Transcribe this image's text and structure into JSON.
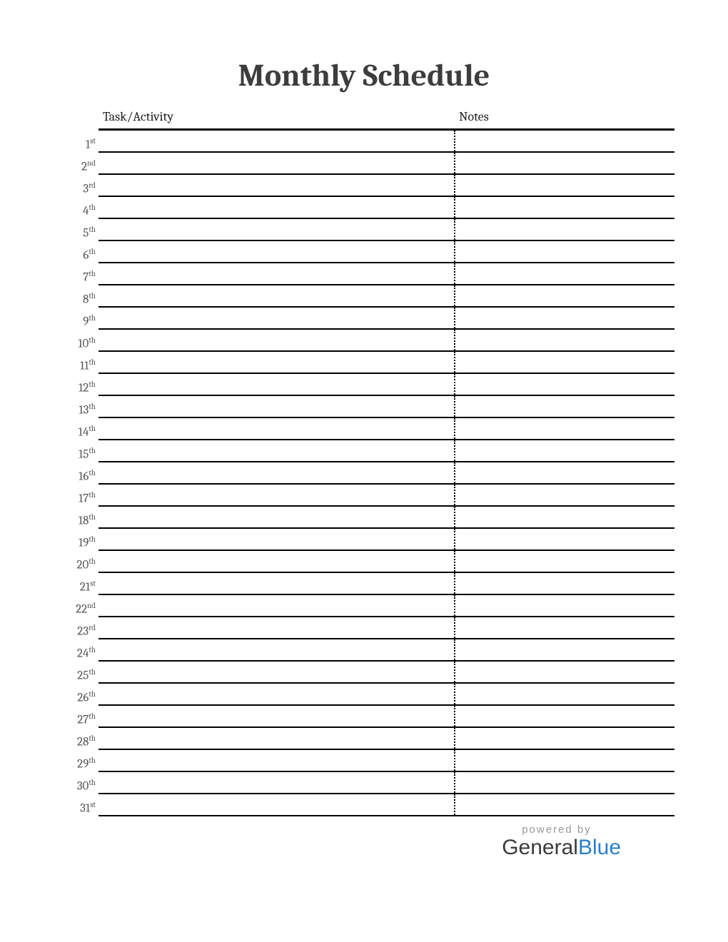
{
  "title": "Monthly Schedule",
  "columns": {
    "task": "Task/Activity",
    "notes": "Notes"
  },
  "days": [
    {
      "num": "1",
      "suffix": "st"
    },
    {
      "num": "2",
      "suffix": "nd"
    },
    {
      "num": "3",
      "suffix": "rd"
    },
    {
      "num": "4",
      "suffix": "th"
    },
    {
      "num": "5",
      "suffix": "th"
    },
    {
      "num": "6",
      "suffix": "th"
    },
    {
      "num": "7",
      "suffix": "th"
    },
    {
      "num": "8",
      "suffix": "th"
    },
    {
      "num": "9",
      "suffix": "th"
    },
    {
      "num": "10",
      "suffix": "th"
    },
    {
      "num": "11",
      "suffix": "th"
    },
    {
      "num": "12",
      "suffix": "th"
    },
    {
      "num": "13",
      "suffix": "th"
    },
    {
      "num": "14",
      "suffix": "th"
    },
    {
      "num": "15",
      "suffix": "th"
    },
    {
      "num": "16",
      "suffix": "th"
    },
    {
      "num": "17",
      "suffix": "th"
    },
    {
      "num": "18",
      "suffix": "th"
    },
    {
      "num": "19",
      "suffix": "th"
    },
    {
      "num": "20",
      "suffix": "th"
    },
    {
      "num": "21",
      "suffix": "st"
    },
    {
      "num": "22",
      "suffix": "nd"
    },
    {
      "num": "23",
      "suffix": "rd"
    },
    {
      "num": "24",
      "suffix": "th"
    },
    {
      "num": "25",
      "suffix": "th"
    },
    {
      "num": "26",
      "suffix": "th"
    },
    {
      "num": "27",
      "suffix": "th"
    },
    {
      "num": "28",
      "suffix": "th"
    },
    {
      "num": "29",
      "suffix": "th"
    },
    {
      "num": "30",
      "suffix": "th"
    },
    {
      "num": "31",
      "suffix": "st"
    }
  ],
  "footer": {
    "powered": "powered by",
    "brand1": "General",
    "brand2": "Blue"
  }
}
